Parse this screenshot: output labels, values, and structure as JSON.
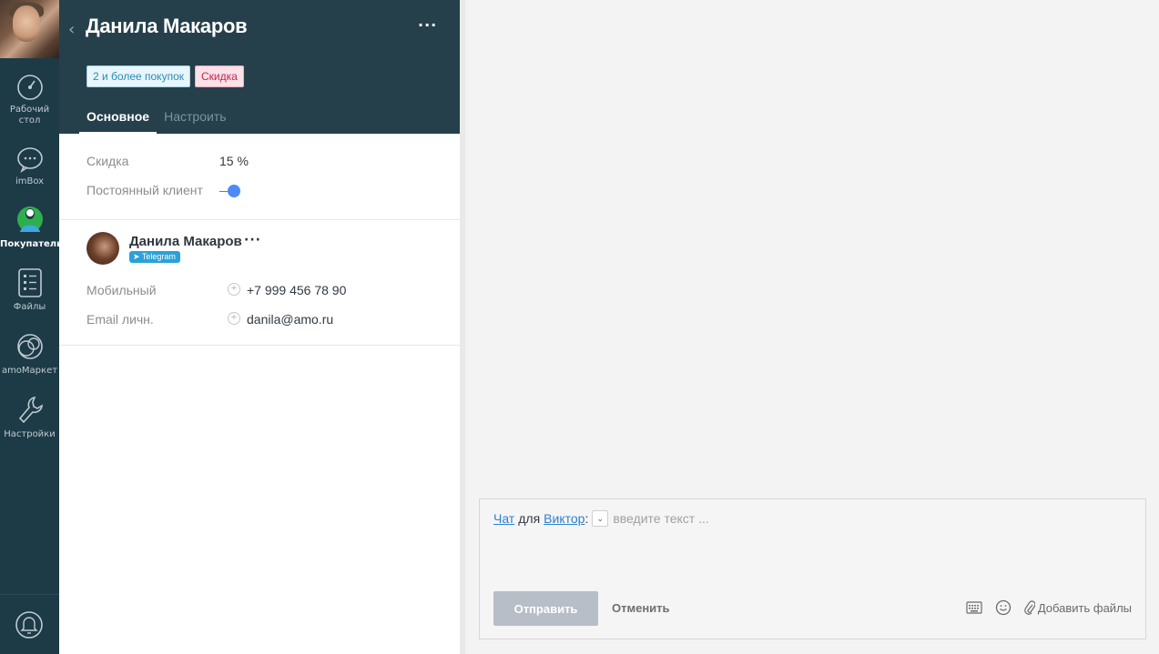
{
  "nav": {
    "items": [
      {
        "label_1": "Рабочий",
        "label_2": "стол",
        "icon": "dashboard-icon"
      },
      {
        "label": "imBox",
        "icon": "chat-bubble-icon"
      },
      {
        "label": "Покупатели",
        "icon": "customers-icon"
      },
      {
        "label": "Файлы",
        "icon": "files-icon"
      },
      {
        "label": "amoМаркет",
        "icon": "market-icon"
      },
      {
        "label": "Настройки",
        "icon": "wrench-icon"
      }
    ],
    "bottom_icon": "bell-icon",
    "active": "Покупатели"
  },
  "card": {
    "back": "‹",
    "title": "Данила Макаров",
    "more": "···",
    "tags": [
      "2 и более покупок",
      "Скидка"
    ],
    "tabs": [
      "Основное",
      "Настроить"
    ],
    "fields": {
      "discount_label": "Скидка",
      "discount_value": "15 %",
      "regular_label": "Постоянный клиент",
      "regular_on": true
    },
    "contact": {
      "name": "Данила Макаров",
      "more": "···",
      "channel": "Telegram",
      "phone_label": "Мобильный",
      "phone": "+7 999 456 78 90",
      "email_label": "Email личн.",
      "email": "danila@amo.ru"
    }
  },
  "composer": {
    "mode": "Чат",
    "for": "для",
    "recipient": "Виктор",
    "colon": ":",
    "placeholder": "введите текст ...",
    "send": "Отправить",
    "cancel": "Отменить",
    "attach": "Добавить файлы"
  },
  "colors": {
    "nav_bg": "#1d3a47",
    "header_bg": "#25404b",
    "toggle": "#4c8bf5",
    "link": "#2f7fd0"
  }
}
